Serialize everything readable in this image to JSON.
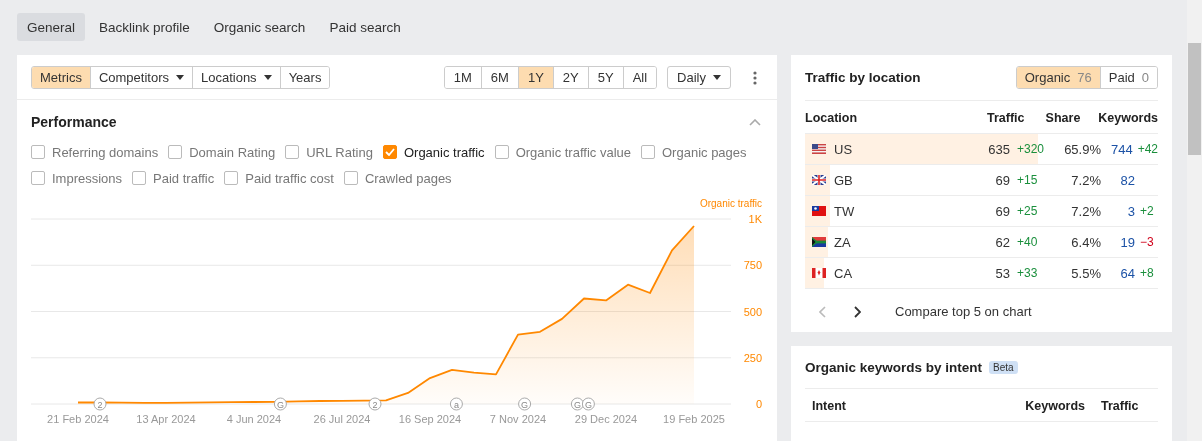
{
  "tabs": [
    {
      "label": "General",
      "selected": true
    },
    {
      "label": "Backlink profile",
      "selected": false
    },
    {
      "label": "Organic search",
      "selected": false
    },
    {
      "label": "Paid search",
      "selected": false
    }
  ],
  "view_buttons": [
    {
      "label": "Metrics",
      "selected": true,
      "dropdown": false
    },
    {
      "label": "Competitors",
      "selected": false,
      "dropdown": true
    },
    {
      "label": "Locations",
      "selected": false,
      "dropdown": true
    },
    {
      "label": "Years",
      "selected": false,
      "dropdown": false
    }
  ],
  "range_buttons": [
    {
      "label": "1M",
      "selected": false
    },
    {
      "label": "6M",
      "selected": false
    },
    {
      "label": "1Y",
      "selected": true
    },
    {
      "label": "2Y",
      "selected": false
    },
    {
      "label": "5Y",
      "selected": false
    },
    {
      "label": "All",
      "selected": false
    }
  ],
  "interval": {
    "value": "Daily"
  },
  "performance": {
    "title": "Performance",
    "expanded": true,
    "metrics": [
      [
        {
          "label": "Referring domains",
          "checked": false
        },
        {
          "label": "Domain Rating",
          "checked": false
        },
        {
          "label": "URL Rating",
          "checked": false
        },
        {
          "label": "Organic traffic",
          "checked": true
        },
        {
          "label": "Organic traffic value",
          "checked": false
        },
        {
          "label": "Organic pages",
          "checked": false
        }
      ],
      [
        {
          "label": "Impressions",
          "checked": false
        },
        {
          "label": "Paid traffic",
          "checked": false
        },
        {
          "label": "Paid traffic cost",
          "checked": false
        },
        {
          "label": "Crawled pages",
          "checked": false
        }
      ]
    ],
    "chart_data": {
      "type": "area",
      "categories": [
        "21 Feb 2024",
        null,
        null,
        null,
        "13 Apr 2024",
        null,
        null,
        null,
        "4 Jun 2024",
        null,
        null,
        null,
        "26 Jul 2024",
        null,
        null,
        null,
        "16 Sep 2024",
        null,
        null,
        null,
        "7 Nov 2024",
        null,
        null,
        null,
        "29 Dec 2024",
        null,
        null,
        null,
        "19 Feb 2025"
      ],
      "series": [
        {
          "name": "Organic traffic",
          "color": "#ff8800",
          "values": [
            8,
            8,
            7,
            6,
            6,
            7,
            9,
            10,
            11,
            12,
            14,
            16,
            17,
            18,
            20,
            60,
            140,
            185,
            170,
            160,
            375,
            390,
            460,
            570,
            560,
            645,
            600,
            830,
            962
          ]
        }
      ],
      "ylim": [
        0,
        1000
      ],
      "grid": true,
      "yticks": [
        0,
        250,
        500,
        750,
        {
          "value": 1000,
          "label": "1K"
        }
      ],
      "annotations": [
        {
          "text": "2"
        },
        {
          "text": "G"
        },
        {
          "text": "2"
        },
        {
          "text": "a"
        },
        {
          "text": "G"
        },
        {
          "text": "G"
        },
        {
          "text": "G"
        }
      ]
    }
  },
  "traffic_by_location": {
    "title": "Traffic by location",
    "toggles": [
      {
        "label": "Organic",
        "count": "76",
        "selected": true
      },
      {
        "label": "Paid",
        "count": "0",
        "selected": false
      }
    ],
    "columns": [
      "Location",
      "Traffic",
      "Share",
      "Keywords"
    ],
    "rows": [
      {
        "kind": "us",
        "location": "US",
        "traffic": "635",
        "traffic_change": {
          "text": "+320",
          "color": "#1a8f3c"
        },
        "share": "65.9%",
        "level": 0.659,
        "keywords": "744",
        "keywords_change": {
          "text": "+42",
          "color": "#1a8f3c"
        }
      },
      {
        "kind": "gb",
        "location": "GB",
        "traffic": "69",
        "traffic_change": {
          "text": "+15",
          "color": "#1a8f3c"
        },
        "share": "7.2%",
        "level": 0.072,
        "keywords": "82"
      },
      {
        "kind": "tw",
        "location": "TW",
        "traffic": "69",
        "traffic_change": {
          "text": "+25",
          "color": "#1a8f3c"
        },
        "share": "7.2%",
        "level": 0.072,
        "keywords": "3",
        "keywords_change": {
          "text": "+2",
          "color": "#1a8f3c"
        }
      },
      {
        "kind": "za",
        "location": "ZA",
        "traffic": "62",
        "traffic_change": {
          "text": "+40",
          "color": "#1a8f3c"
        },
        "share": "6.4%",
        "level": 0.064,
        "keywords": "19",
        "keywords_change": {
          "text": "−3",
          "color": "#d0021b"
        }
      },
      {
        "kind": "ca",
        "location": "CA",
        "traffic": "53",
        "traffic_change": {
          "text": "+33",
          "color": "#1a8f3c"
        },
        "share": "5.5%",
        "level": 0.055,
        "keywords": "64",
        "keywords_change": {
          "text": "+8",
          "color": "#1a8f3c"
        }
      }
    ],
    "prev_disabled": true,
    "compare_link": "Compare top 5 on chart"
  },
  "keywords_by_intent": {
    "title": "Organic keywords by intent",
    "badge": "Beta",
    "columns": [
      "Intent",
      "Keywords",
      "Traffic"
    ]
  }
}
